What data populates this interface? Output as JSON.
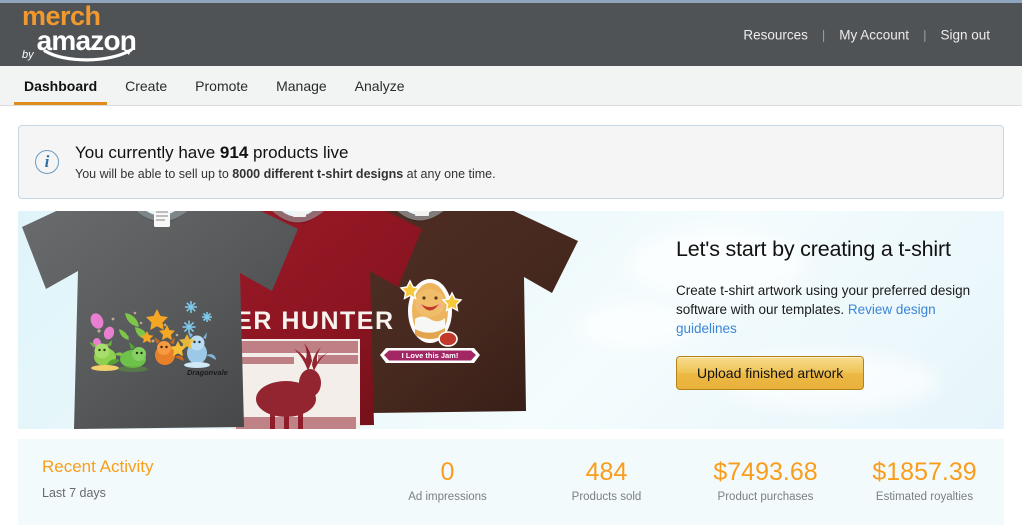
{
  "brand": {
    "merch": "merch",
    "by": "by",
    "amazon": "amazon"
  },
  "header": {
    "links": [
      {
        "label": "Resources"
      },
      {
        "label": "My Account"
      },
      {
        "label": "Sign out"
      }
    ],
    "separator": "|"
  },
  "tabs": [
    {
      "label": "Dashboard",
      "active": true
    },
    {
      "label": "Create",
      "active": false
    },
    {
      "label": "Promote",
      "active": false
    },
    {
      "label": "Manage",
      "active": false
    },
    {
      "label": "Analyze",
      "active": false
    }
  ],
  "banner": {
    "icon": "info-icon",
    "icon_glyph": "i",
    "line1_prefix": "You currently have ",
    "line1_count": "914",
    "line1_suffix": " products live",
    "line2_prefix": "You will be able to sell up to ",
    "line2_bold": "8000 different t-shirt designs",
    "line2_suffix": " at any one time."
  },
  "hero": {
    "title": "Let's start by creating a t-shirt",
    "body_text": "Create t-shirt artwork using your preferred design software with our templates. ",
    "link_label": "Review design guidelines",
    "button_label": "Upload finished artwork",
    "shirts": [
      {
        "name": "dragon-shirt",
        "color": "#5b5c5e",
        "artwork_caption": "Dragonvale"
      },
      {
        "name": "deer-hunter-shirt",
        "color": "#8e1622",
        "artwork_caption": "DEER HUNTER"
      },
      {
        "name": "jam-toast-shirt",
        "color": "#4a2a20",
        "artwork_caption": "I Love this Jam!"
      }
    ]
  },
  "activity": {
    "title": "Recent Activity",
    "subtitle": "Last 7 days",
    "stats": [
      {
        "value": "0",
        "label": "Ad impressions"
      },
      {
        "value": "484",
        "label": "Products sold"
      },
      {
        "value": "$7493.68",
        "label": "Product purchases"
      },
      {
        "value": "$1857.39",
        "label": "Estimated royalties"
      }
    ]
  },
  "colors": {
    "header_bg": "#4f5355",
    "accent_orange": "#f99d1c",
    "tab_underline": "#dd8c1d",
    "link_blue": "#3b85d6",
    "button_gold": "#ecb944",
    "activity_bg": "#f3fafb"
  }
}
